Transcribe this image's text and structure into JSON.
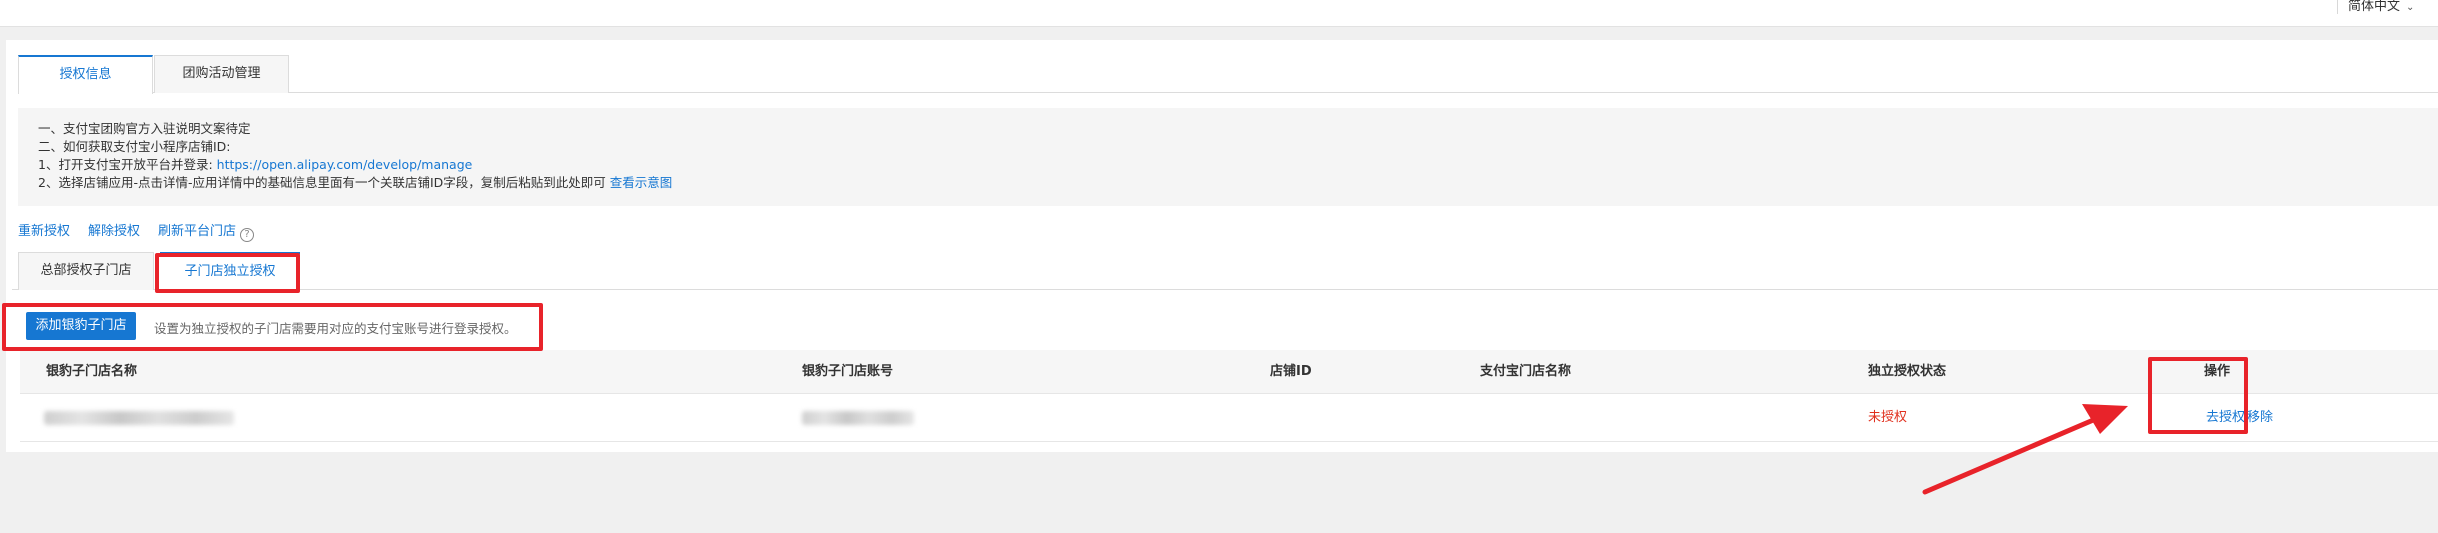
{
  "topbar": {
    "language": "简体中文",
    "language_icon": "chevron-down-icon"
  },
  "tabs": [
    {
      "label": "授权信息",
      "active": true
    },
    {
      "label": "团购活动管理",
      "active": false
    }
  ],
  "info": {
    "line1": "一、支付宝团购官方入驻说明文案待定",
    "line2": "二、如何获取支付宝小程序店铺ID:",
    "line3_prefix": "1、打开支付宝开放平台并登录: ",
    "line3_link": "https://open.alipay.com/develop/manage",
    "line4_prefix": "2、选择店铺应用-点击详情-应用详情中的基础信息里面有一个关联店铺ID字段，复制后粘贴到此处即可 ",
    "line4_link": "查看示意图"
  },
  "actions": {
    "reauthorize": "重新授权",
    "revoke": "解除授权",
    "refresh_stores": "刷新平台门店",
    "help_icon": "question-circle-icon"
  },
  "subtabs": [
    {
      "label": "总部授权子门店",
      "active": false
    },
    {
      "label": "子门店独立授权",
      "active": true
    }
  ],
  "add_button": "添加银豹子门店",
  "add_hint": "设置为独立授权的子门店需要用对应的支付宝账号进行登录授权。",
  "table": {
    "columns": [
      "银豹子门店名称",
      "银豹子门店账号",
      "店铺ID",
      "支付宝门店名称",
      "独立授权状态",
      "操作"
    ],
    "rows": [
      {
        "store_name": "",
        "store_account": "",
        "shop_id": "",
        "alipay_store_name": "",
        "status": "未授权",
        "op_authorize": "去授权",
        "op_remove": "移除"
      }
    ]
  },
  "colors": {
    "accent": "#1677d2",
    "danger": "#e0301e",
    "annotation": "#e8232a"
  }
}
